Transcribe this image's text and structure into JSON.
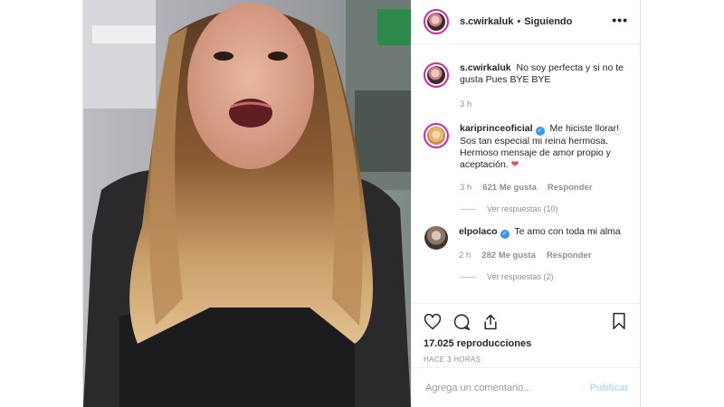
{
  "header": {
    "username": "s.cwirkaluk",
    "separator": "•",
    "follow_status": "Siguiendo",
    "more_icon": "more-options-icon"
  },
  "caption": {
    "username": "s.cwirkaluk",
    "text": "No soy perfecta y si no te gusta Pues BYE BYE",
    "time": "3 h"
  },
  "comments": [
    {
      "username": "kariprinceoficial",
      "verified": true,
      "text": "Me hiciste llorar! Sos tan especial mi reina hermosa. Hermoso mensaje de amor propio y aceptación.",
      "emoji": "❤",
      "time": "3 h",
      "likes": "621 Me gusta",
      "reply": "Responder",
      "view_replies": "Ver respuestas (10)"
    },
    {
      "username": "elpolaco",
      "verified": true,
      "text": "Te amo con toda mi alma",
      "time": "2 h",
      "likes": "282 Me gusta",
      "reply": "Responder",
      "view_replies": "Ver respuestas (2)"
    }
  ],
  "actions": {
    "views": "17.025 reproducciones",
    "age": "HACE 3 HORAS"
  },
  "comment_box": {
    "placeholder": "Agrega un comentario...",
    "publish": "Publicar"
  },
  "colors": {
    "verified": "#3897f0",
    "heart_red": "#ed4956",
    "publish_disabled": "#b2dffc",
    "story_ring": "#d6249f"
  }
}
